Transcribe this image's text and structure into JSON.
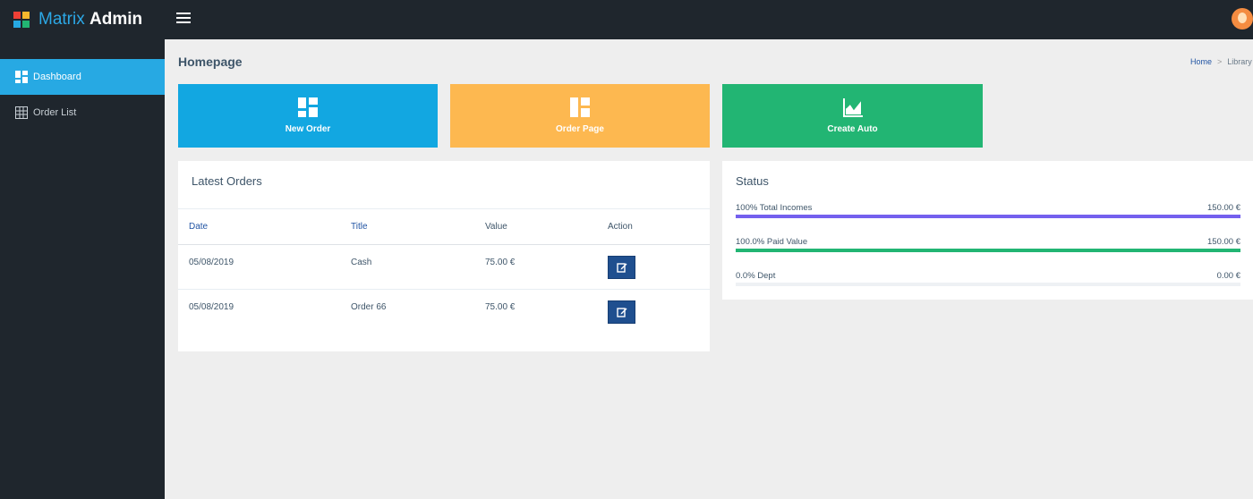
{
  "app": {
    "logo_light": "Matrix",
    "logo_bold": "Admin"
  },
  "colors": {
    "sidebar_bg": "#1f262d",
    "active_nav": "#27a9e3",
    "tile_blue": "#12a7e1",
    "tile_orange": "#fdb850",
    "tile_green": "#22b573",
    "bar_purple": "#7460ee",
    "bar_green": "#22b573",
    "edit_button": "#1f4f8f"
  },
  "sidebar": {
    "items": [
      {
        "label": "Dashboard",
        "icon": "dashboard-icon",
        "active": true
      },
      {
        "label": "Order List",
        "icon": "grid-icon",
        "active": false
      }
    ]
  },
  "page": {
    "title": "Homepage",
    "breadcrumb": {
      "home": "Home",
      "current": "Library"
    }
  },
  "tiles": [
    {
      "label": "New Order",
      "icon": "dashboard-icon"
    },
    {
      "label": "Order Page",
      "icon": "layout-icon"
    },
    {
      "label": "Create Auto",
      "icon": "area-chart-icon"
    }
  ],
  "orders": {
    "title": "Latest Orders",
    "columns": [
      "Date",
      "Title",
      "Value",
      "Action"
    ],
    "rows": [
      {
        "date": "05/08/2019",
        "title": "Cash",
        "value": "75.00 €",
        "action_icon": "edit-icon"
      },
      {
        "date": "05/08/2019",
        "title": "Order 66",
        "value": "75.00 €",
        "action_icon": "edit-icon"
      }
    ]
  },
  "status": {
    "title": "Status",
    "items": [
      {
        "label": "100% Total Incomes",
        "value": "150.00 €",
        "progress": 1.0,
        "color": "#7460ee"
      },
      {
        "label": "100.0% Paid Value",
        "value": "150.00 €",
        "progress": 1.0,
        "color": "#22b573"
      },
      {
        "label": "0.0% Dept",
        "value": "0.00 €",
        "progress": 0.0,
        "color": "#22b573"
      }
    ]
  }
}
